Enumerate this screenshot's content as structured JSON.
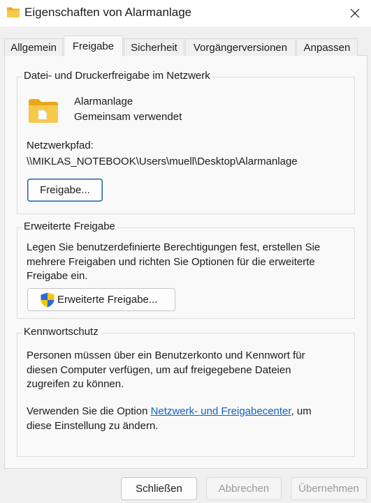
{
  "window": {
    "title": "Eigenschaften von Alarmanlage",
    "close_glyph": "✕"
  },
  "tabs": [
    {
      "label": "Allgemein",
      "active": false
    },
    {
      "label": "Freigabe",
      "active": true
    },
    {
      "label": "Sicherheit",
      "active": false
    },
    {
      "label": "Vorgängerversionen",
      "active": false
    },
    {
      "label": "Anpassen",
      "active": false
    }
  ],
  "network_sharing": {
    "legend": "Datei- und Druckerfreigabe im Netzwerk",
    "folder_name": "Alarmanlage",
    "status": "Gemeinsam verwendet",
    "path_label": "Netzwerkpfad:",
    "path": "\\\\MIKLAS_NOTEBOOK\\Users\\muell\\Desktop\\Alarmanlage",
    "share_button": "Freigabe..."
  },
  "advanced_sharing": {
    "legend": "Erweiterte Freigabe",
    "lines": [
      "Legen Sie benutzerdefinierte Berechtigungen fest, erstellen Sie",
      "mehrere Freigaben und richten Sie Optionen für die erweiterte",
      "Freigabe ein."
    ],
    "button": "Erweiterte Freigabe..."
  },
  "password_protection": {
    "legend": "Kennwortschutz",
    "lines": [
      "Personen müssen über ein Benutzerkonto und Kennwort für",
      "diesen Computer verfügen, um auf freigegebene Dateien",
      "zugreifen zu können."
    ],
    "option_prefix": "Verwenden Sie die Option ",
    "option_link": "Netzwerk- und Freigabecenter",
    "option_suffix": ", um",
    "option_line2": "diese Einstellung zu ändern."
  },
  "footer": {
    "close": "Schließen",
    "cancel": "Abbrechen",
    "apply": "Übernehmen"
  },
  "colors": {
    "folder": "#f5c02c",
    "link": "#0b63c5",
    "default_button_border": "#1e5fa8",
    "shield_blue": "#2a6ad8",
    "shield_yellow": "#f6c700"
  }
}
